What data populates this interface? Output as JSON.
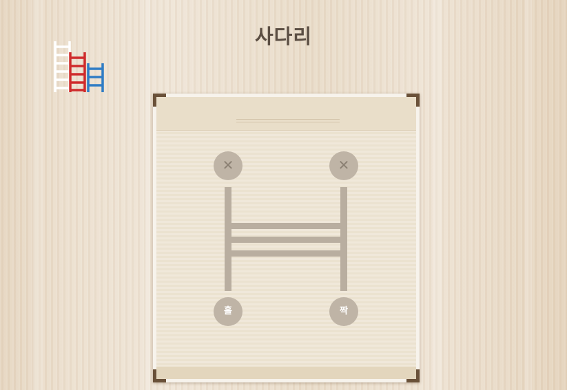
{
  "page": {
    "title": "사다리"
  },
  "icons": {
    "logo": "ladder-logo-icon",
    "remove": "close-icon"
  },
  "colors": {
    "ladder_white": "#ffffff",
    "ladder_red": "#cf2b2b",
    "ladder_blue": "#2f7cc5",
    "rail": "#b9aea0",
    "slot": "#bfb4a6"
  },
  "game": {
    "players": [
      {
        "remove_symbol": "✕",
        "result": "홀"
      },
      {
        "remove_symbol": "✕",
        "result": "짝"
      }
    ],
    "rungs": 3
  }
}
